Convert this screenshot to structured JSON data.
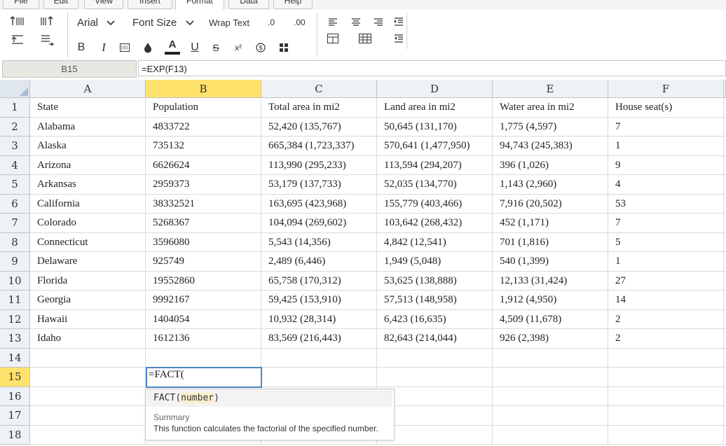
{
  "menu": {
    "tabs": [
      {
        "label": "File"
      },
      {
        "label": "Edit"
      },
      {
        "label": "View"
      },
      {
        "label": "Insert"
      },
      {
        "label": "Format"
      },
      {
        "label": "Data"
      },
      {
        "label": "Help"
      }
    ],
    "active_tab": "Format"
  },
  "toolbar": {
    "font_name": "Arial",
    "font_size_label": "Font Size",
    "wrap_text": "Wrap Text",
    "decrease_decimal": ".0",
    "increase_decimal": ".00",
    "bold": "B",
    "italic": "I",
    "underline": "U",
    "strikethrough": "S",
    "superscript": "x²",
    "font_color_letter": "A",
    "icons": [
      "indent-rows-icon",
      "outdent-rows-icon",
      "align-top-icon",
      "align-bottom-icon",
      "border-icon",
      "fill-color-icon",
      "currency-icon",
      "format-cells-icon",
      "align-left-icon",
      "align-center-icon",
      "align-right-icon",
      "indent-icon",
      "outdent-icon",
      "table-icon",
      "table-grid-icon"
    ]
  },
  "formula_bar": {
    "cell_ref": "B15",
    "formula": "=EXP(F13)"
  },
  "sheet": {
    "columns": [
      "A",
      "B",
      "C",
      "D",
      "E",
      "F"
    ],
    "selected_column": "B",
    "selected_row": "15",
    "row_numbers": [
      "1",
      "2",
      "3",
      "4",
      "5",
      "6",
      "7",
      "8",
      "9",
      "10",
      "11",
      "12",
      "13",
      "14",
      "15",
      "16",
      "17",
      "18"
    ],
    "rows": [
      [
        "State",
        "Population",
        "Total area in mi2",
        "Land area in mi2",
        "Water area in mi2",
        "House seat(s)"
      ],
      [
        "Alabama",
        "4833722",
        "52,420 (135,767)",
        "50,645 (131,170)",
        "1,775 (4,597)",
        "7"
      ],
      [
        "Alaska",
        "735132",
        "665,384 (1,723,337)",
        "570,641 (1,477,950)",
        "94,743 (245,383)",
        "1"
      ],
      [
        "Arizona",
        "6626624",
        "113,990 (295,233)",
        "113,594 (294,207)",
        "396 (1,026)",
        "9"
      ],
      [
        "Arkansas",
        "2959373",
        "53,179 (137,733)",
        "52,035 (134,770)",
        "1,143 (2,960)",
        "4"
      ],
      [
        "California",
        "38332521",
        "163,695 (423,968)",
        "155,779 (403,466)",
        "7,916 (20,502)",
        "53"
      ],
      [
        "Colorado",
        "5268367",
        "104,094 (269,602)",
        "103,642 (268,432)",
        "452 (1,171)",
        "7"
      ],
      [
        "Connecticut",
        "3596080",
        "5,543 (14,356)",
        "4,842 (12,541)",
        "701 (1,816)",
        "5"
      ],
      [
        "Delaware",
        "925749",
        "2,489 (6,446)",
        "1,949 (5,048)",
        "540 (1,399)",
        "1"
      ],
      [
        "Florida",
        "19552860",
        "65,758 (170,312)",
        "53,625 (138,888)",
        "12,133 (31,424)",
        "27"
      ],
      [
        "Georgia",
        "9992167",
        "59,425 (153,910)",
        "57,513 (148,958)",
        "1,912 (4,950)",
        "14"
      ],
      [
        "Hawaii",
        "1404054",
        "10,932 (28,314)",
        "6,423 (16,635)",
        "4,509 (11,678)",
        "2"
      ],
      [
        "Idaho",
        "1612136",
        "83,569 (216,443)",
        "82,643 (214,044)",
        "926 (2,398)",
        "2"
      ],
      [
        "",
        "",
        "",
        "",
        "",
        ""
      ],
      [
        "",
        "",
        "",
        "",
        "",
        ""
      ],
      [
        "",
        "",
        "",
        "",
        "",
        ""
      ],
      [
        "",
        "",
        "",
        "",
        "",
        ""
      ],
      [
        "",
        "",
        "",
        "",
        "",
        ""
      ]
    ],
    "editing_cell_value": "=FACT("
  },
  "autocomplete": {
    "fn_name": "FACT",
    "open_paren": "(",
    "param": "number",
    "close_paren": ")",
    "summary_label": "Summary",
    "description": "This function calculates the factorial of the specified number."
  },
  "colors": {
    "selection_header": "#ffe26b",
    "editor_border": "#4f86c6",
    "header_bg": "#eef1f5"
  }
}
